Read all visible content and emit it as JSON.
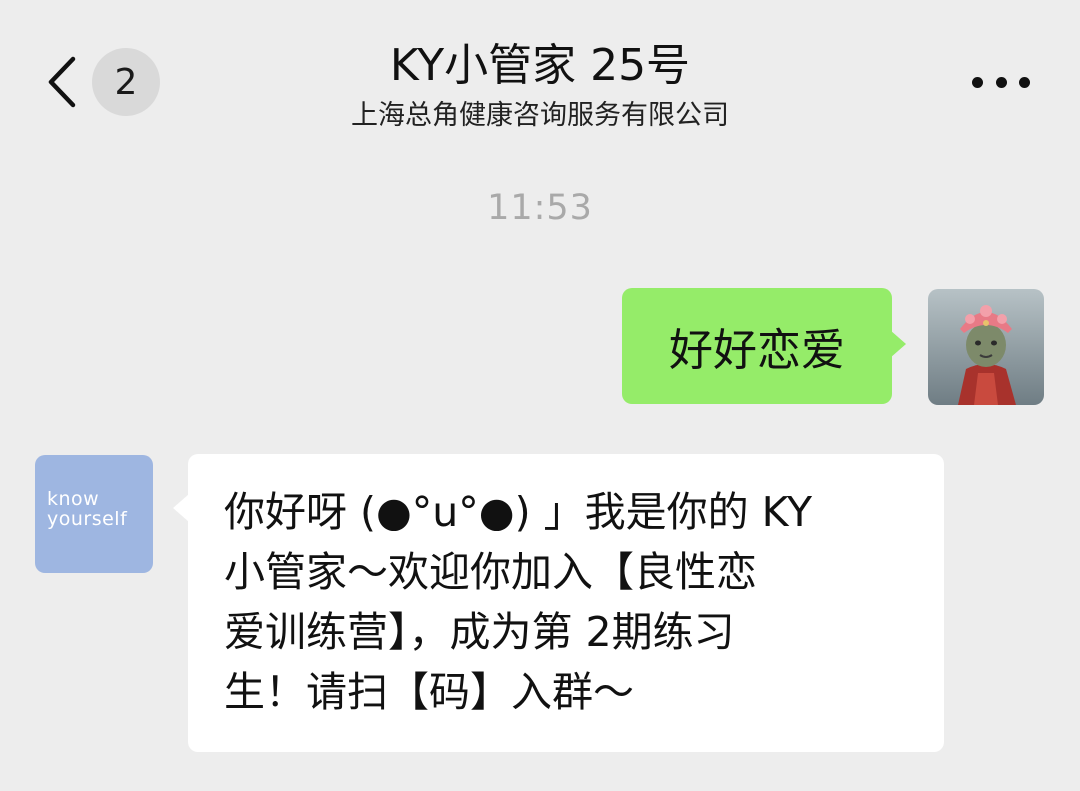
{
  "header": {
    "back_icon": "chevron-left-icon",
    "unread_count": "2",
    "title": "KY小管家 25号",
    "subtitle": "上海总角健康咨询服务有限公司",
    "more_icon": "ellipsis-icon"
  },
  "chat": {
    "timestamp": "11:53",
    "messages": [
      {
        "sender": "me",
        "text": "好好恋爱"
      },
      {
        "sender": "KY小管家",
        "avatar_text": "know yourself",
        "lines": [
          "你好呀 (●°u°●) 」我是你的 KY",
          "小管家～欢迎你加入【良性恋",
          "爱训练营】，成为第 2期练习",
          "生！请扫【码】入群～"
        ]
      }
    ]
  },
  "colors": {
    "background": "#ededed",
    "sent_bubble": "#95ec69",
    "received_bubble": "#ffffff",
    "ky_avatar": "#9eb6e1",
    "timestamp": "#a9a9a9"
  }
}
